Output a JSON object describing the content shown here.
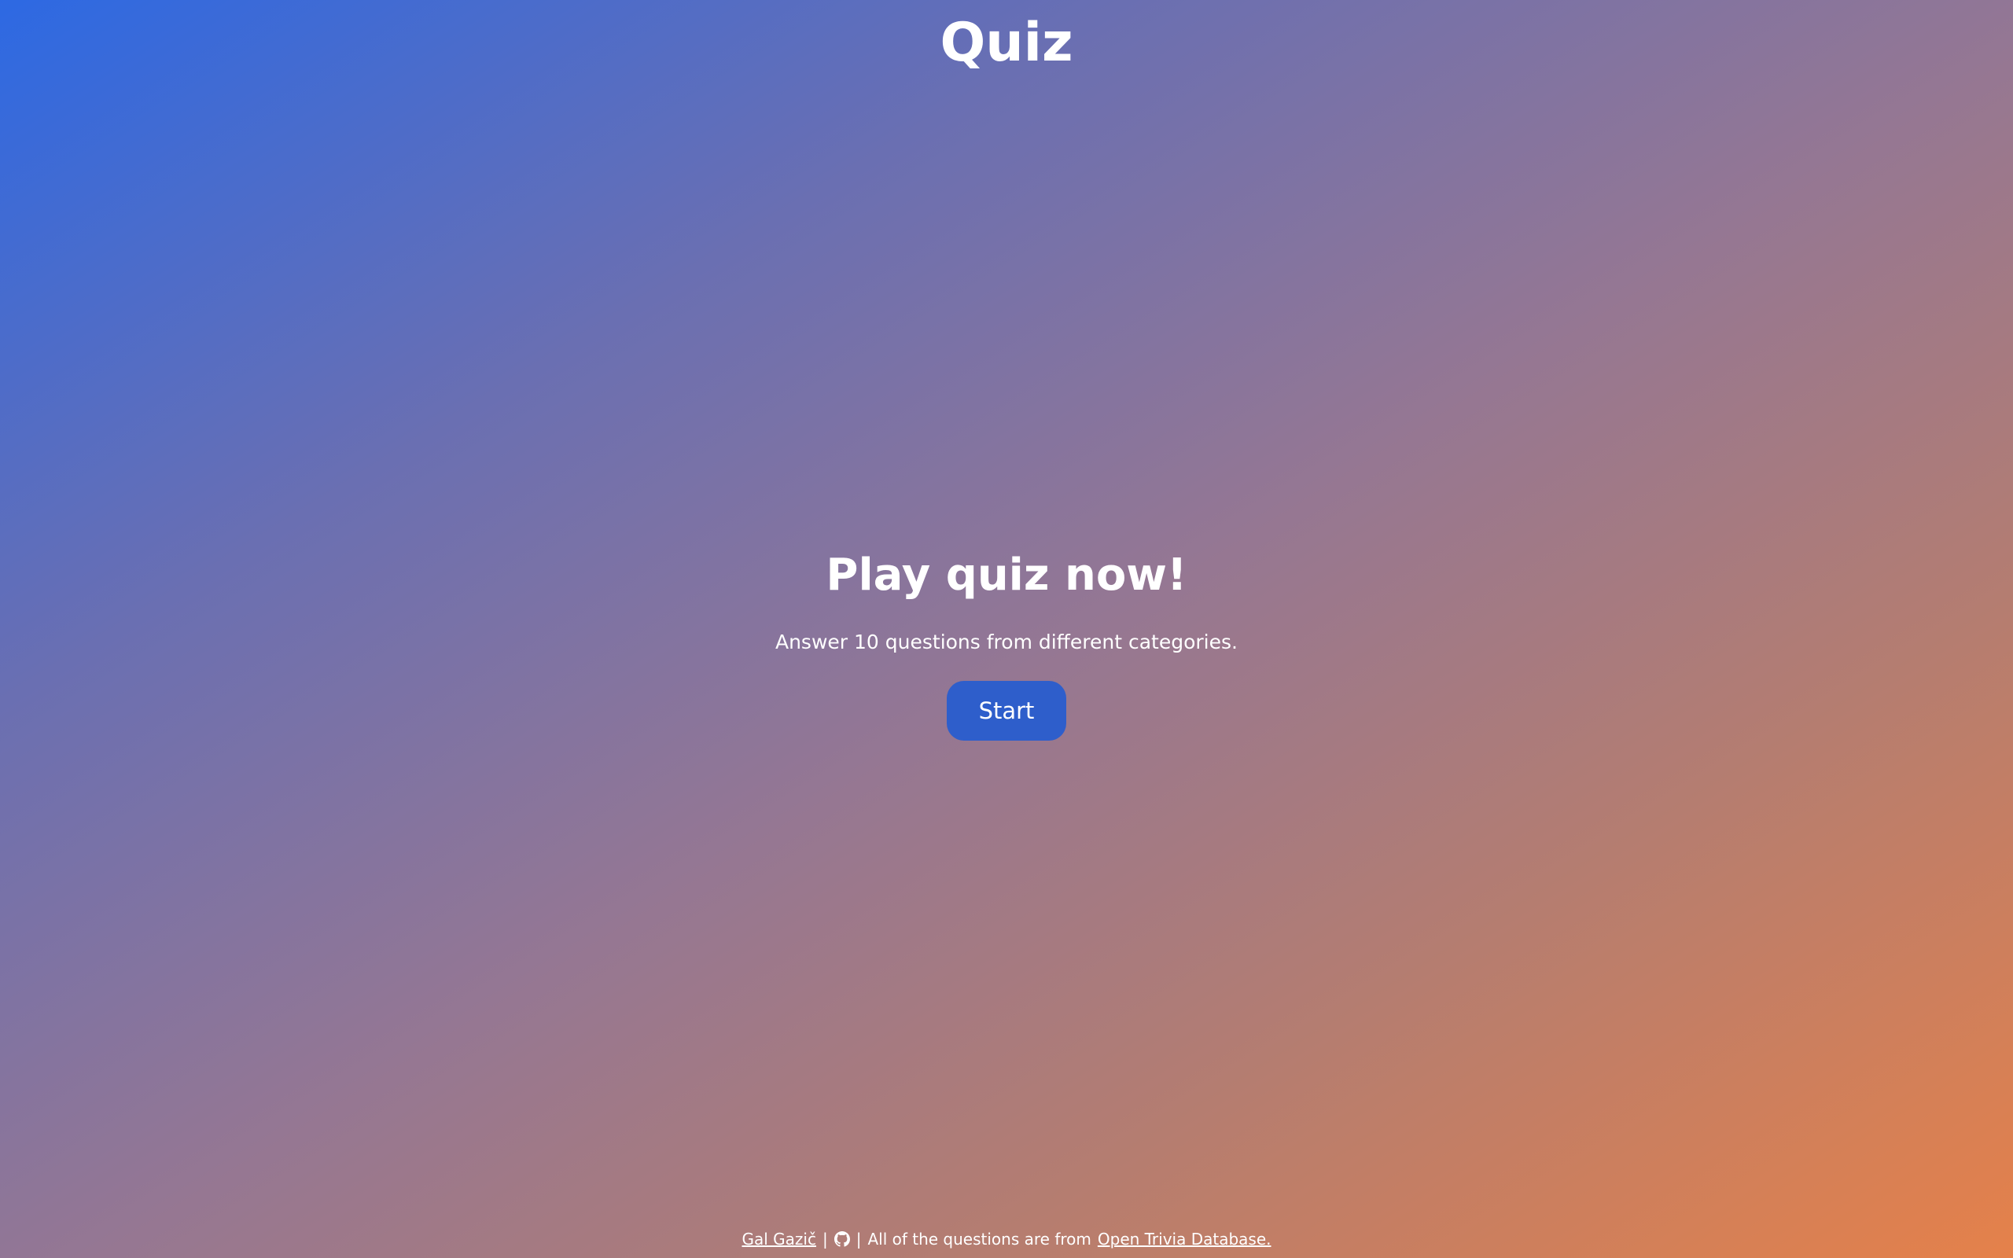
{
  "header": {
    "title": "Quiz"
  },
  "main": {
    "headline": "Play quiz now!",
    "subtitle": "Answer 10 questions from different categories.",
    "start_label": "Start",
    "start_button_color": "#2e5ecb"
  },
  "footer": {
    "author_link": "Gal Gazič",
    "separator": "|",
    "github_icon": "github-icon",
    "credit_text": "All of the questions are from",
    "source_link": "Open Trivia Database."
  },
  "theme": {
    "gradient_start": "#2d69e3",
    "gradient_end": "#e5814a"
  }
}
